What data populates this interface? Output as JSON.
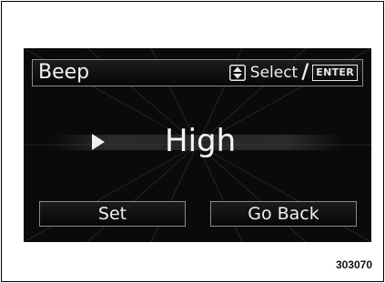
{
  "header": {
    "title": "Beep",
    "select_label": "Select",
    "slash": "/",
    "enter_label": "ENTER",
    "updown_icon": "up-down-arrows-icon"
  },
  "setting": {
    "value": "High",
    "pointer_icon": "right-triangle-icon"
  },
  "buttons": {
    "set_label": "Set",
    "go_back_label": "Go Back"
  },
  "figure": {
    "code": "303070"
  },
  "colors": {
    "screen_background": "#0a0a0a",
    "text": "#f2f2f2",
    "border": "#8c8c8c"
  }
}
